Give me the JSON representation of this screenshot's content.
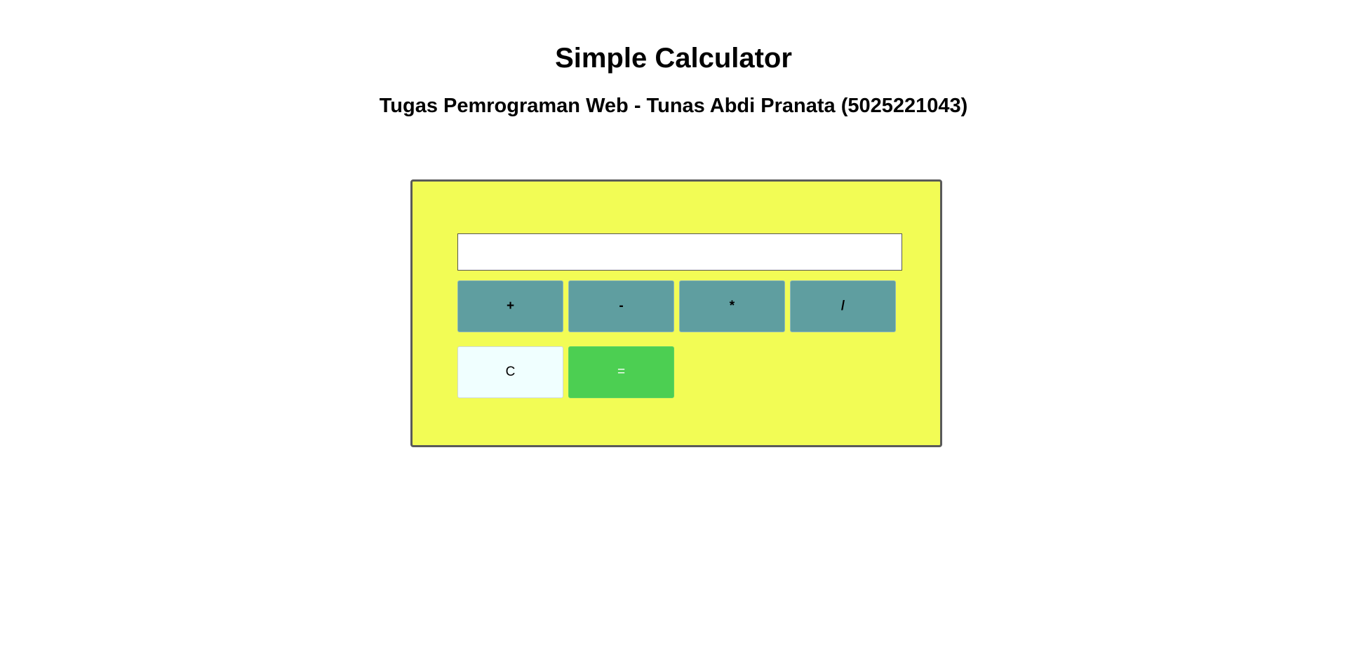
{
  "header": {
    "title": "Simple Calculator",
    "subtitle": "Tugas Pemrograman Web - Tunas Abdi Pranata (5025221043)"
  },
  "calculator": {
    "display_value": "",
    "operators": {
      "add": "+",
      "subtract": "-",
      "multiply": "*",
      "divide": "/"
    },
    "clear_label": "C",
    "equals_label": "="
  },
  "colors": {
    "panel_background": "#f2fc55",
    "panel_border": "#5a5a5a",
    "operator_button": "#5f9ea0",
    "clear_button": "#f0ffff",
    "equals_button": "#4ccf52"
  }
}
